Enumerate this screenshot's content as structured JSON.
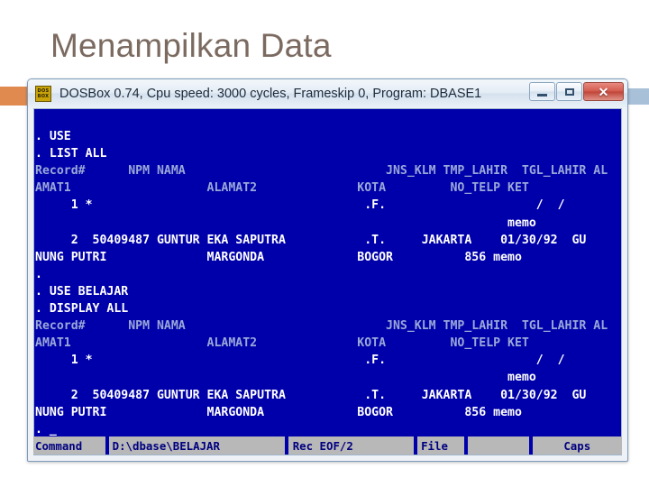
{
  "slide": {
    "title": "Menampilkan Data",
    "title_color": "#7b6a60",
    "left_bar_color": "#e08a50",
    "right_bar_color": "#a8c0d8"
  },
  "window": {
    "icon_name": "dosbox-icon",
    "icon_line1": "DOS",
    "icon_line2": "BOX",
    "title": "DOSBox 0.74, Cpu speed:     3000 cycles, Frameskip  0, Program:   DBASE1",
    "buttons": {
      "minimize": "minimize",
      "maximize": "maximize",
      "close": "✕"
    }
  },
  "terminal": {
    "background": "#0000aa",
    "text_color": "#ffffff",
    "dim_color": "#9aa8d8",
    "lines": [
      {
        "kind": "blank",
        "text": ""
      },
      {
        "kind": "normal",
        "text": ". USE"
      },
      {
        "kind": "normal",
        "text": ". LIST ALL"
      },
      {
        "kind": "dim",
        "text": "Record#      NPM NAMA                            JNS_KLM TMP_LAHIR  TGL_LAHIR AL"
      },
      {
        "kind": "dim",
        "text": "AMAT1                   ALAMAT2              KOTA         NO_TELP KET"
      },
      {
        "kind": "normal",
        "text": "     1 *                                      .F.                     /  /"
      },
      {
        "kind": "normal",
        "text": "                                                                  memo"
      },
      {
        "kind": "normal",
        "text": "     2  50409487 GUNTUR EKA SAPUTRA           .T.     JAKARTA    01/30/92  GU"
      },
      {
        "kind": "normal",
        "text": "NUNG PUTRI              MARGONDA             BOGOR          856 memo"
      },
      {
        "kind": "normal",
        "text": "."
      },
      {
        "kind": "normal",
        "text": ". USE BELAJAR"
      },
      {
        "kind": "normal",
        "text": ". DISPLAY ALL"
      },
      {
        "kind": "dim",
        "text": "Record#      NPM NAMA                            JNS_KLM TMP_LAHIR  TGL_LAHIR AL"
      },
      {
        "kind": "dim",
        "text": "AMAT1                   ALAMAT2              KOTA         NO_TELP KET"
      },
      {
        "kind": "normal",
        "text": "     1 *                                      .F.                     /  /"
      },
      {
        "kind": "normal",
        "text": "                                                                  memo"
      },
      {
        "kind": "normal",
        "text": "     2  50409487 GUNTUR EKA SAPUTRA           .T.     JAKARTA    01/30/92  GU"
      },
      {
        "kind": "normal",
        "text": "NUNG PUTRI              MARGONDA             BOGOR          856 memo"
      },
      {
        "kind": "normal",
        "text": ". _"
      }
    ]
  },
  "status_bar": {
    "mode": "Command",
    "path": "D:\\dbase\\BELAJAR",
    "record": "Rec EOF/2",
    "file": "File",
    "spare": "",
    "caps": "Caps"
  }
}
